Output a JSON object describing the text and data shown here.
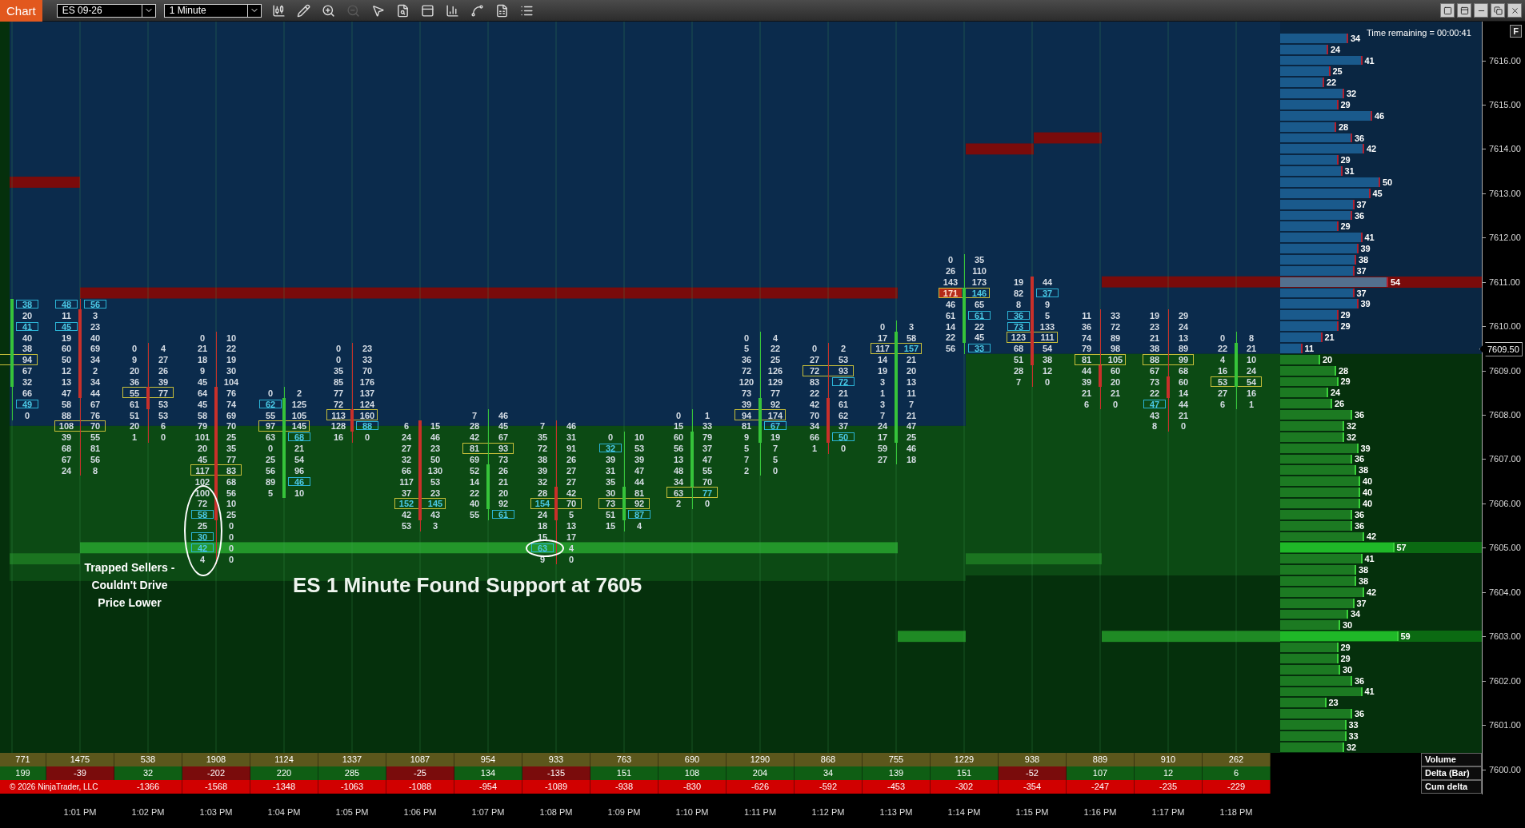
{
  "toolbar": {
    "tab": "Chart",
    "instrument": "ES 09-26",
    "interval": "1 Minute",
    "tools": [
      {
        "kind": "bars",
        "disabled": false
      },
      {
        "kind": "draw",
        "disabled": false
      },
      {
        "kind": "zoom_in",
        "disabled": false
      },
      {
        "kind": "zoom_out",
        "disabled": true
      },
      {
        "kind": "pointer",
        "disabled": false
      },
      {
        "kind": "data_box",
        "disabled": false
      },
      {
        "kind": "template",
        "disabled": false
      },
      {
        "kind": "indicators",
        "disabled": false
      },
      {
        "kind": "strategies",
        "disabled": false
      },
      {
        "kind": "properties",
        "disabled": false
      },
      {
        "kind": "list",
        "disabled": false
      }
    ]
  },
  "time_remaining": "Time remaining = 00:00:41",
  "f_button": "F",
  "footprint_bars": [
    {
      "rising": true,
      "rows": [
        {
          "ask": "38",
          "ask_imbalance": true,
          "poc": false
        },
        {
          "ask": "20",
          "poc": false
        },
        {
          "ask": "41",
          "ask_imbalance": true,
          "poc": false
        },
        {
          "ask": "40",
          "poc": false
        },
        {
          "ask": "38",
          "poc": false
        },
        {
          "ask": "94",
          "poc": true
        },
        {
          "ask": "67",
          "poc": false
        },
        {
          "ask": "32",
          "poc": false
        },
        {
          "ask": "66",
          "poc": false
        },
        {
          "ask": "49",
          "ask_imbalance": true,
          "poc": false
        },
        {
          "ask": "0",
          "poc": false
        }
      ]
    },
    {
      "rising": false,
      "rows": [
        {
          "bid": "48",
          "ask": "56",
          "bid_imbalance": true,
          "ask_imbalance": true,
          "poc": false
        },
        {
          "bid": "11",
          "ask": "3",
          "poc": false
        },
        {
          "bid": "45",
          "ask": "23",
          "bid_imbalance": true,
          "poc": false
        },
        {
          "bid": "19",
          "ask": "40",
          "poc": false
        },
        {
          "bid": "60",
          "ask": "69",
          "poc": false
        },
        {
          "bid": "50",
          "ask": "34",
          "poc": false
        },
        {
          "bid": "12",
          "ask": "2",
          "poc": false
        },
        {
          "bid": "13",
          "ask": "34",
          "poc": false
        },
        {
          "bid": "47",
          "ask": "44",
          "poc": false
        },
        {
          "bid": "58",
          "ask": "67",
          "poc": false
        },
        {
          "bid": "88",
          "ask": "76",
          "poc": false
        },
        {
          "bid": "108",
          "ask": "70",
          "poc": true
        },
        {
          "bid": "39",
          "ask": "55",
          "poc": false
        },
        {
          "bid": "68",
          "ask": "81",
          "poc": false
        },
        {
          "bid": "67",
          "ask": "56",
          "poc": false
        },
        {
          "bid": "24",
          "ask": "8",
          "poc": false
        }
      ]
    },
    {
      "rising": false,
      "rows": [
        {
          "bid": "0",
          "ask": "4",
          "poc": false
        },
        {
          "bid": "9",
          "ask": "27",
          "poc": false
        },
        {
          "bid": "20",
          "ask": "26",
          "poc": false
        },
        {
          "bid": "36",
          "ask": "39",
          "poc": false
        },
        {
          "bid": "55",
          "ask": "77",
          "poc": true
        },
        {
          "bid": "61",
          "ask": "53",
          "poc": false
        },
        {
          "bid": "51",
          "ask": "53",
          "poc": false
        },
        {
          "bid": "20",
          "ask": "6",
          "poc": false
        },
        {
          "bid": "1",
          "ask": "0",
          "poc": false
        }
      ]
    },
    {
      "rising": false,
      "rows": [
        {
          "bid": "0",
          "ask": "10",
          "poc": false
        },
        {
          "bid": "21",
          "ask": "22",
          "poc": false
        },
        {
          "bid": "18",
          "ask": "19",
          "poc": false
        },
        {
          "bid": "9",
          "ask": "30",
          "poc": false
        },
        {
          "bid": "45",
          "ask": "104",
          "poc": false
        },
        {
          "bid": "64",
          "ask": "76",
          "poc": false
        },
        {
          "bid": "45",
          "ask": "74",
          "poc": false
        },
        {
          "bid": "58",
          "ask": "69",
          "poc": false
        },
        {
          "bid": "79",
          "ask": "70",
          "poc": false
        },
        {
          "bid": "101",
          "ask": "25",
          "poc": false
        },
        {
          "bid": "20",
          "ask": "35",
          "poc": false
        },
        {
          "bid": "45",
          "ask": "77",
          "poc": false
        },
        {
          "bid": "117",
          "ask": "83",
          "poc": true
        },
        {
          "bid": "102",
          "ask": "68",
          "poc": false
        },
        {
          "bid": "100",
          "ask": "56",
          "poc": false
        },
        {
          "bid": "72",
          "ask": "10",
          "poc": false
        },
        {
          "bid": "58",
          "ask": "25",
          "bid_imbalance": true,
          "poc": false
        },
        {
          "bid": "25",
          "ask": "0",
          "poc": false
        },
        {
          "bid": "30",
          "ask": "0",
          "bid_imbalance": true,
          "poc": false
        },
        {
          "bid": "42",
          "ask": "0",
          "bid_imbalance": true,
          "poc": false
        },
        {
          "bid": "4",
          "ask": "0",
          "poc": false
        }
      ]
    },
    {
      "rising": true,
      "rows": [
        {
          "bid": "0",
          "ask": "2",
          "poc": false
        },
        {
          "bid": "62",
          "ask": "125",
          "bid_imbalance": true,
          "poc": false
        },
        {
          "bid": "55",
          "ask": "105",
          "poc": false
        },
        {
          "bid": "97",
          "ask": "145",
          "poc": true
        },
        {
          "bid": "63",
          "ask": "68",
          "ask_imbalance": true,
          "poc": false
        },
        {
          "bid": "0",
          "ask": "21",
          "poc": false
        },
        {
          "bid": "25",
          "ask": "54",
          "poc": false
        },
        {
          "bid": "56",
          "ask": "96",
          "poc": false
        },
        {
          "bid": "89",
          "ask": "46",
          "ask_imbalance": true,
          "poc": false
        },
        {
          "bid": "5",
          "ask": "10",
          "poc": false
        }
      ]
    },
    {
      "rising": false,
      "rows": [
        {
          "bid": "0",
          "ask": "23",
          "poc": false
        },
        {
          "bid": "0",
          "ask": "33",
          "poc": false
        },
        {
          "bid": "35",
          "ask": "70",
          "poc": false
        },
        {
          "bid": "85",
          "ask": "176",
          "poc": false
        },
        {
          "bid": "77",
          "ask": "137",
          "poc": false
        },
        {
          "bid": "72",
          "ask": "124",
          "poc": false
        },
        {
          "bid": "113",
          "ask": "160",
          "poc": true
        },
        {
          "bid": "128",
          "ask": "88",
          "ask_imbalance": true,
          "poc": false
        },
        {
          "bid": "16",
          "ask": "0",
          "poc": false
        }
      ]
    },
    {
      "rising": false,
      "rows": [
        {
          "bid": "6",
          "ask": "15",
          "poc": false
        },
        {
          "bid": "24",
          "ask": "46",
          "poc": false
        },
        {
          "bid": "27",
          "ask": "23",
          "poc": false
        },
        {
          "bid": "32",
          "ask": "50",
          "poc": false
        },
        {
          "bid": "66",
          "ask": "130",
          "poc": false
        },
        {
          "bid": "117",
          "ask": "53",
          "poc": false
        },
        {
          "bid": "37",
          "ask": "23",
          "poc": false
        },
        {
          "bid": "152",
          "ask": "145",
          "bid_imbalance": true,
          "ask_imbalance": true,
          "poc": true
        },
        {
          "bid": "42",
          "ask": "43",
          "poc": false
        },
        {
          "bid": "53",
          "ask": "3",
          "poc": false
        }
      ]
    },
    {
      "rising": true,
      "rows": [
        {
          "bid": "7",
          "ask": "46",
          "poc": false
        },
        {
          "bid": "28",
          "ask": "45",
          "poc": false
        },
        {
          "bid": "42",
          "ask": "67",
          "poc": false
        },
        {
          "bid": "81",
          "ask": "93",
          "poc": true
        },
        {
          "bid": "69",
          "ask": "73",
          "poc": false
        },
        {
          "bid": "52",
          "ask": "26",
          "poc": false
        },
        {
          "bid": "14",
          "ask": "21",
          "poc": false
        },
        {
          "bid": "22",
          "ask": "20",
          "poc": false
        },
        {
          "bid": "40",
          "ask": "92",
          "poc": false
        },
        {
          "bid": "55",
          "ask": "61",
          "ask_imbalance": true,
          "poc": false
        }
      ]
    },
    {
      "rising": false,
      "rows": [
        {
          "bid": "7",
          "ask": "46",
          "poc": false
        },
        {
          "bid": "35",
          "ask": "31",
          "poc": false
        },
        {
          "bid": "72",
          "ask": "91",
          "poc": false
        },
        {
          "bid": "38",
          "ask": "26",
          "poc": false
        },
        {
          "bid": "39",
          "ask": "27",
          "poc": false
        },
        {
          "bid": "32",
          "ask": "27",
          "poc": false
        },
        {
          "bid": "28",
          "ask": "42",
          "poc": false
        },
        {
          "bid": "154",
          "ask": "70",
          "bid_imbalance": true,
          "poc": true
        },
        {
          "bid": "24",
          "ask": "5",
          "poc": false
        },
        {
          "bid": "18",
          "ask": "13",
          "poc": false
        },
        {
          "bid": "15",
          "ask": "17",
          "poc": false
        },
        {
          "bid": "63",
          "ask": "4",
          "bid_imbalance": true,
          "poc": false
        },
        {
          "bid": "9",
          "ask": "0",
          "poc": false
        }
      ]
    },
    {
      "rising": true,
      "rows": [
        {
          "bid": "0",
          "ask": "10",
          "poc": false
        },
        {
          "bid": "32",
          "ask": "53",
          "bid_imbalance": true,
          "poc": false
        },
        {
          "bid": "39",
          "ask": "39",
          "poc": false
        },
        {
          "bid": "31",
          "ask": "47",
          "poc": false
        },
        {
          "bid": "35",
          "ask": "44",
          "poc": false
        },
        {
          "bid": "30",
          "ask": "81",
          "poc": false
        },
        {
          "bid": "73",
          "ask": "92",
          "poc": true
        },
        {
          "bid": "51",
          "ask": "87",
          "ask_imbalance": true,
          "poc": false
        },
        {
          "bid": "15",
          "ask": "4",
          "poc": false
        }
      ]
    },
    {
      "rising": true,
      "rows": [
        {
          "bid": "0",
          "ask": "1",
          "poc": false
        },
        {
          "bid": "15",
          "ask": "33",
          "poc": false
        },
        {
          "bid": "60",
          "ask": "79",
          "poc": false
        },
        {
          "bid": "56",
          "ask": "37",
          "poc": false
        },
        {
          "bid": "13",
          "ask": "47",
          "poc": false
        },
        {
          "bid": "48",
          "ask": "55",
          "poc": false
        },
        {
          "bid": "34",
          "ask": "70",
          "poc": false
        },
        {
          "bid": "63",
          "ask": "77",
          "ask_imbalance": true,
          "poc": true
        },
        {
          "bid": "2",
          "ask": "0",
          "poc": false
        }
      ]
    },
    {
      "rising": true,
      "rows": [
        {
          "bid": "0",
          "ask": "4",
          "poc": false
        },
        {
          "bid": "5",
          "ask": "22",
          "poc": false
        },
        {
          "bid": "36",
          "ask": "25",
          "poc": false
        },
        {
          "bid": "72",
          "ask": "126",
          "poc": false
        },
        {
          "bid": "120",
          "ask": "129",
          "poc": false
        },
        {
          "bid": "73",
          "ask": "77",
          "poc": false
        },
        {
          "bid": "39",
          "ask": "92",
          "poc": false
        },
        {
          "bid": "94",
          "ask": "174",
          "poc": true
        },
        {
          "bid": "81",
          "ask": "67",
          "ask_imbalance": true,
          "poc": false
        },
        {
          "bid": "9",
          "ask": "19",
          "poc": false
        },
        {
          "bid": "5",
          "ask": "7",
          "poc": false
        },
        {
          "bid": "7",
          "ask": "5",
          "poc": false
        },
        {
          "bid": "2",
          "ask": "0",
          "poc": false
        }
      ]
    },
    {
      "rising": false,
      "rows": [
        {
          "bid": "0",
          "ask": "2",
          "poc": false
        },
        {
          "bid": "27",
          "ask": "53",
          "poc": false
        },
        {
          "bid": "72",
          "ask": "93",
          "poc": true
        },
        {
          "bid": "83",
          "ask": "72",
          "ask_imbalance": true,
          "poc": false
        },
        {
          "bid": "22",
          "ask": "21",
          "poc": false
        },
        {
          "bid": "42",
          "ask": "61",
          "poc": false
        },
        {
          "bid": "70",
          "ask": "62",
          "poc": false
        },
        {
          "bid": "34",
          "ask": "37",
          "poc": false
        },
        {
          "bid": "66",
          "ask": "50",
          "ask_imbalance": true,
          "poc": false
        },
        {
          "bid": "1",
          "ask": "0",
          "poc": false
        }
      ]
    },
    {
      "rising": true,
      "rows": [
        {
          "bid": "0",
          "ask": "3",
          "poc": false
        },
        {
          "bid": "17",
          "ask": "58",
          "poc": false
        },
        {
          "bid": "117",
          "ask": "157",
          "ask_imbalance": true,
          "poc": true
        },
        {
          "bid": "14",
          "ask": "21",
          "poc": false
        },
        {
          "bid": "19",
          "ask": "20",
          "poc": false
        },
        {
          "bid": "3",
          "ask": "13",
          "poc": false
        },
        {
          "bid": "1",
          "ask": "11",
          "poc": false
        },
        {
          "bid": "3",
          "ask": "7",
          "poc": false
        },
        {
          "bid": "7",
          "ask": "21",
          "poc": false
        },
        {
          "bid": "24",
          "ask": "47",
          "poc": false
        },
        {
          "bid": "17",
          "ask": "25",
          "poc": false
        },
        {
          "bid": "59",
          "ask": "46",
          "poc": false
        },
        {
          "bid": "27",
          "ask": "18",
          "poc": false
        }
      ]
    },
    {
      "rising": true,
      "rows": [
        {
          "bid": "0",
          "ask": "35",
          "poc": false
        },
        {
          "bid": "26",
          "ask": "110",
          "poc": false
        },
        {
          "bid": "143",
          "ask": "173",
          "poc": false
        },
        {
          "bid": "171",
          "ask": "146",
          "bid_hot": true,
          "ask_imbalance": true,
          "poc": true
        },
        {
          "bid": "46",
          "ask": "65",
          "poc": false
        },
        {
          "bid": "61",
          "ask": "61",
          "ask_imbalance": true,
          "poc": false
        },
        {
          "bid": "14",
          "ask": "22",
          "poc": false
        },
        {
          "bid": "22",
          "ask": "45",
          "poc": false
        },
        {
          "bid": "56",
          "ask": "33",
          "ask_imbalance": true,
          "poc": false
        }
      ]
    },
    {
      "rising": false,
      "rows": [
        {
          "bid": "19",
          "ask": "44",
          "poc": false
        },
        {
          "bid": "82",
          "ask": "37",
          "ask_imbalance": true,
          "poc": false
        },
        {
          "bid": "8",
          "ask": "9",
          "poc": false
        },
        {
          "bid": "36",
          "ask": "5",
          "bid_imbalance": true,
          "poc": false
        },
        {
          "bid": "73",
          "ask": "133",
          "bid_imbalance": true,
          "poc": false
        },
        {
          "bid": "123",
          "ask": "111",
          "poc": true
        },
        {
          "bid": "68",
          "ask": "54",
          "poc": false
        },
        {
          "bid": "51",
          "ask": "38",
          "poc": false
        },
        {
          "bid": "28",
          "ask": "12",
          "poc": false
        },
        {
          "bid": "7",
          "ask": "0",
          "poc": false
        }
      ]
    },
    {
      "rising": false,
      "rows": [
        {
          "bid": "11",
          "ask": "33",
          "poc": false
        },
        {
          "bid": "36",
          "ask": "72",
          "poc": false
        },
        {
          "bid": "74",
          "ask": "89",
          "poc": false
        },
        {
          "bid": "79",
          "ask": "98",
          "poc": false
        },
        {
          "bid": "81",
          "ask": "105",
          "poc": true
        },
        {
          "bid": "44",
          "ask": "60",
          "poc": false
        },
        {
          "bid": "39",
          "ask": "20",
          "poc": false
        },
        {
          "bid": "21",
          "ask": "21",
          "poc": false
        },
        {
          "bid": "6",
          "ask": "0",
          "poc": false
        }
      ]
    },
    {
      "rising": false,
      "rows": [
        {
          "bid": "19",
          "ask": "29",
          "poc": false
        },
        {
          "bid": "23",
          "ask": "24",
          "poc": false
        },
        {
          "bid": "21",
          "ask": "13",
          "poc": false
        },
        {
          "bid": "38",
          "ask": "89",
          "poc": false
        },
        {
          "bid": "88",
          "ask": "99",
          "poc": true
        },
        {
          "bid": "67",
          "ask": "68",
          "poc": false
        },
        {
          "bid": "73",
          "ask": "60",
          "poc": false
        },
        {
          "bid": "22",
          "ask": "14",
          "poc": false
        },
        {
          "bid": "47",
          "ask": "44",
          "bid_imbalance": true,
          "poc": false
        },
        {
          "bid": "43",
          "ask": "21",
          "poc": false
        },
        {
          "bid": "8",
          "ask": "0",
          "poc": false
        }
      ]
    },
    {
      "rising": true,
      "rows": [
        {
          "bid": "0",
          "ask": "8",
          "poc": false
        },
        {
          "bid": "22",
          "ask": "21",
          "poc": false
        },
        {
          "bid": "4",
          "ask": "10",
          "poc": false
        },
        {
          "bid": "16",
          "ask": "24",
          "poc": false
        },
        {
          "bid": "53",
          "ask": "54",
          "poc": true
        },
        {
          "bid": "27",
          "ask": "16",
          "poc": false
        },
        {
          "bid": "6",
          "ask": "1",
          "poc": false
        }
      ]
    }
  ],
  "volume_profile": [
    {
      "value": "34",
      "kind": "offer",
      "highlight": false
    },
    {
      "value": "24",
      "kind": "offer",
      "highlight": false
    },
    {
      "value": "41",
      "kind": "offer",
      "highlight": false
    },
    {
      "value": "25",
      "kind": "offer",
      "highlight": false
    },
    {
      "value": "22",
      "kind": "offer",
      "highlight": false
    },
    {
      "value": "32",
      "kind": "offer",
      "highlight": false
    },
    {
      "value": "29",
      "kind": "offer",
      "highlight": false
    },
    {
      "value": "46",
      "kind": "offer",
      "highlight": false
    },
    {
      "value": "28",
      "kind": "offer",
      "highlight": false
    },
    {
      "value": "36",
      "kind": "offer",
      "highlight": false
    },
    {
      "value": "42",
      "kind": "offer",
      "highlight": false
    },
    {
      "value": "29",
      "kind": "offer",
      "highlight": false
    },
    {
      "value": "31",
      "kind": "offer",
      "highlight": false
    },
    {
      "value": "50",
      "kind": "offer",
      "highlight": false
    },
    {
      "value": "45",
      "kind": "offer",
      "highlight": false
    },
    {
      "value": "37",
      "kind": "offer",
      "highlight": false
    },
    {
      "value": "36",
      "kind": "offer",
      "highlight": false
    },
    {
      "value": "29",
      "kind": "offer",
      "highlight": false
    },
    {
      "value": "41",
      "kind": "offer",
      "highlight": false
    },
    {
      "value": "39",
      "kind": "offer",
      "highlight": false
    },
    {
      "value": "38",
      "kind": "offer",
      "highlight": false
    },
    {
      "value": "37",
      "kind": "offer",
      "highlight": false
    },
    {
      "value": "54",
      "kind": "offer",
      "highlight": true
    },
    {
      "value": "37",
      "kind": "offer",
      "highlight": false
    },
    {
      "value": "39",
      "kind": "offer",
      "highlight": false
    },
    {
      "value": "29",
      "kind": "offer",
      "highlight": false
    },
    {
      "value": "29",
      "kind": "offer",
      "highlight": false
    },
    {
      "value": "21",
      "kind": "offer",
      "highlight": false
    },
    {
      "value": "11",
      "kind": "offer",
      "highlight": false
    },
    {
      "value": "20",
      "kind": "bid",
      "highlight": false
    },
    {
      "value": "28",
      "kind": "bid",
      "highlight": false
    },
    {
      "value": "29",
      "kind": "bid",
      "highlight": false
    },
    {
      "value": "24",
      "kind": "bid",
      "highlight": false
    },
    {
      "value": "26",
      "kind": "bid",
      "highlight": false
    },
    {
      "value": "36",
      "kind": "bid",
      "highlight": false
    },
    {
      "value": "32",
      "kind": "bid",
      "highlight": false
    },
    {
      "value": "32",
      "kind": "bid",
      "highlight": false
    },
    {
      "value": "39",
      "kind": "bid",
      "highlight": false
    },
    {
      "value": "36",
      "kind": "bid",
      "highlight": false
    },
    {
      "value": "38",
      "kind": "bid",
      "highlight": false
    },
    {
      "value": "40",
      "kind": "bid",
      "highlight": false
    },
    {
      "value": "40",
      "kind": "bid",
      "highlight": false
    },
    {
      "value": "40",
      "kind": "bid",
      "highlight": false
    },
    {
      "value": "36",
      "kind": "bid",
      "highlight": false
    },
    {
      "value": "36",
      "kind": "bid",
      "highlight": false
    },
    {
      "value": "42",
      "kind": "bid",
      "highlight": false
    },
    {
      "value": "57",
      "kind": "bid",
      "highlight": true
    },
    {
      "value": "41",
      "kind": "bid",
      "highlight": false
    },
    {
      "value": "38",
      "kind": "bid",
      "highlight": false
    },
    {
      "value": "38",
      "kind": "bid",
      "highlight": false
    },
    {
      "value": "42",
      "kind": "bid",
      "highlight": false
    },
    {
      "value": "37",
      "kind": "bid",
      "highlight": false
    },
    {
      "value": "34",
      "kind": "bid",
      "highlight": false
    },
    {
      "value": "30",
      "kind": "bid",
      "highlight": false
    },
    {
      "value": "59",
      "kind": "bid",
      "highlight": true
    },
    {
      "value": "29",
      "kind": "bid",
      "highlight": false
    },
    {
      "value": "29",
      "kind": "bid",
      "highlight": false
    },
    {
      "value": "30",
      "kind": "bid",
      "highlight": false
    },
    {
      "value": "36",
      "kind": "bid",
      "highlight": false
    },
    {
      "value": "41",
      "kind": "bid",
      "highlight": false
    },
    {
      "value": "23",
      "kind": "bid",
      "highlight": false
    },
    {
      "value": "36",
      "kind": "bid",
      "highlight": false
    },
    {
      "value": "33",
      "kind": "bid",
      "highlight": false
    },
    {
      "value": "33",
      "kind": "bid",
      "highlight": false
    },
    {
      "value": "32",
      "kind": "bid",
      "highlight": false
    }
  ],
  "price_axis": {
    "labels": [
      "7616.00",
      "7615.00",
      "7614.00",
      "7613.00",
      "7612.00",
      "7611.00",
      "7610.00",
      "7609.00",
      "7608.00",
      "7607.00",
      "7606.00",
      "7605.00",
      "7604.00",
      "7603.00",
      "7602.00",
      "7601.00",
      "7600.00"
    ],
    "current_price": "7609.50"
  },
  "annotations": {
    "note_lines": [
      "Trapped Sellers -",
      "Couldn't Drive",
      "Price Lower"
    ],
    "headline": "ES 1 Minute Found Support at 7605"
  },
  "stats_table": {
    "row_labels": [
      "Volume",
      "Delta (Bar)",
      "Cum delta"
    ],
    "copyright": "© 2026 NinjaTrader, LLC",
    "columns": [
      {
        "volume": "771",
        "delta": "199",
        "color": "#0f5e14"
      },
      {
        "volume": "1475",
        "delta": "-39",
        "color": "#7a0c0c"
      },
      {
        "volume": "538",
        "delta": "32",
        "color": "#0f5e14",
        "cum_delta": "-1366"
      },
      {
        "volume": "1908",
        "delta": "-202",
        "color": "#7a0c0c",
        "cum_delta": "-1568"
      },
      {
        "volume": "1124",
        "delta": "220",
        "color": "#0f5e14",
        "cum_delta": "-1348"
      },
      {
        "volume": "1337",
        "delta": "285",
        "color": "#0f5e14",
        "cum_delta": "-1063"
      },
      {
        "volume": "1087",
        "delta": "-25",
        "color": "#7a0c0c",
        "cum_delta": "-1088"
      },
      {
        "volume": "954",
        "delta": "134",
        "color": "#0f5e14",
        "cum_delta": "-954"
      },
      {
        "volume": "933",
        "delta": "-135",
        "color": "#7a0c0c",
        "cum_delta": "-1089"
      },
      {
        "volume": "763",
        "delta": "151",
        "color": "#0f5e14",
        "cum_delta": "-938"
      },
      {
        "volume": "690",
        "delta": "108",
        "color": "#0f5e14",
        "cum_delta": "-830"
      },
      {
        "volume": "1290",
        "delta": "204",
        "color": "#0f5e14",
        "cum_delta": "-626"
      },
      {
        "volume": "868",
        "delta": "34",
        "color": "#0f5e14",
        "cum_delta": "-592"
      },
      {
        "volume": "755",
        "delta": "139",
        "color": "#0f5e14",
        "cum_delta": "-453"
      },
      {
        "volume": "1229",
        "delta": "151",
        "color": "#0f5e14",
        "cum_delta": "-302"
      },
      {
        "volume": "938",
        "delta": "-52",
        "color": "#7a0c0c",
        "cum_delta": "-354"
      },
      {
        "volume": "889",
        "delta": "107",
        "color": "#0f5e14",
        "cum_delta": "-247"
      },
      {
        "volume": "910",
        "delta": "12",
        "color": "#0f5e14",
        "cum_delta": "-235"
      },
      {
        "volume": "262",
        "delta": "6",
        "color": "#0f5e14",
        "cum_delta": "-229"
      }
    ]
  },
  "time_axis": [
    "1:01 PM",
    "1:02 PM",
    "1:03 PM",
    "1:04 PM",
    "1:05 PM",
    "1:06 PM",
    "1:07 PM",
    "1:08 PM",
    "1:09 PM",
    "1:10 PM",
    "1:11 PM",
    "1:12 PM",
    "1:13 PM",
    "1:14 PM",
    "1:15 PM",
    "1:16 PM",
    "1:17 PM",
    "1:18 PM"
  ]
}
